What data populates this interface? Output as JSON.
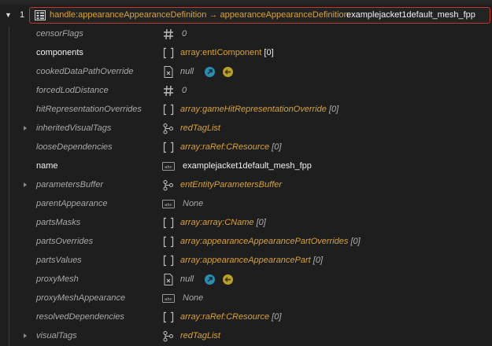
{
  "header": {
    "index": "1",
    "type_label": "handle:appearanceAppearanceDefinition → appearanceAppearanceDefinition",
    "value": "examplejacket1default_mesh_fpp"
  },
  "properties": [
    {
      "name": "censorFlags",
      "kind": "number",
      "value": "0",
      "set": false,
      "expandable": false,
      "icon": "hash-icon"
    },
    {
      "name": "components",
      "kind": "array",
      "type": "array:entIComponent",
      "count": "[0]",
      "set": true,
      "expandable": false,
      "icon": "brackets-icon"
    },
    {
      "name": "cookedDataPathOverride",
      "kind": "null",
      "value": "null",
      "set": false,
      "expandable": false,
      "icon": "file-ref-icon"
    },
    {
      "name": "forcedLodDistance",
      "kind": "number",
      "value": "0",
      "set": false,
      "expandable": false,
      "icon": "hash-icon"
    },
    {
      "name": "hitRepresentationOverrides",
      "kind": "array",
      "type": "array:gameHitRepresentationOverride",
      "count": "[0]",
      "set": false,
      "expandable": false,
      "icon": "brackets-icon"
    },
    {
      "name": "inheritedVisualTags",
      "kind": "ref",
      "value": "redTagList",
      "set": false,
      "expandable": true,
      "icon": "hierarchy-icon"
    },
    {
      "name": "looseDependencies",
      "kind": "array",
      "type": "array:raRef:CResource",
      "count": "[0]",
      "set": false,
      "expandable": false,
      "icon": "brackets-icon"
    },
    {
      "name": "name",
      "kind": "string",
      "value": "examplejacket1default_mesh_fpp",
      "set": true,
      "expandable": false,
      "icon": "abc-icon"
    },
    {
      "name": "parametersBuffer",
      "kind": "ref",
      "value": "entEntityParametersBuffer",
      "set": false,
      "expandable": true,
      "icon": "hierarchy-icon"
    },
    {
      "name": "parentAppearance",
      "kind": "none",
      "value": "None",
      "set": false,
      "expandable": false,
      "icon": "abc-icon"
    },
    {
      "name": "partsMasks",
      "kind": "array",
      "type": "array:array:CName",
      "count": "[0]",
      "set": false,
      "expandable": false,
      "icon": "brackets-icon"
    },
    {
      "name": "partsOverrides",
      "kind": "array",
      "type": "array:appearanceAppearancePartOverrides",
      "count": "[0]",
      "set": false,
      "expandable": false,
      "icon": "brackets-icon"
    },
    {
      "name": "partsValues",
      "kind": "array",
      "type": "array:appearanceAppearancePart",
      "count": "[0]",
      "set": false,
      "expandable": false,
      "icon": "brackets-icon"
    },
    {
      "name": "proxyMesh",
      "kind": "null",
      "value": "null",
      "set": false,
      "expandable": false,
      "icon": "file-ref-icon"
    },
    {
      "name": "proxyMeshAppearance",
      "kind": "none",
      "value": "None",
      "set": false,
      "expandable": false,
      "icon": "abc-icon"
    },
    {
      "name": "resolvedDependencies",
      "kind": "array",
      "type": "array:raRef:CResource",
      "count": "[0]",
      "set": false,
      "expandable": false,
      "icon": "brackets-icon"
    },
    {
      "name": "visualTags",
      "kind": "ref",
      "value": "redTagList",
      "set": false,
      "expandable": true,
      "icon": "hierarchy-icon"
    }
  ],
  "colors": {
    "background": "#1e1e1e",
    "type_accent": "#d7a23a",
    "selection_border": "#c0392b",
    "open_button": "#2e8bb0",
    "back_button": "#b8a022"
  }
}
